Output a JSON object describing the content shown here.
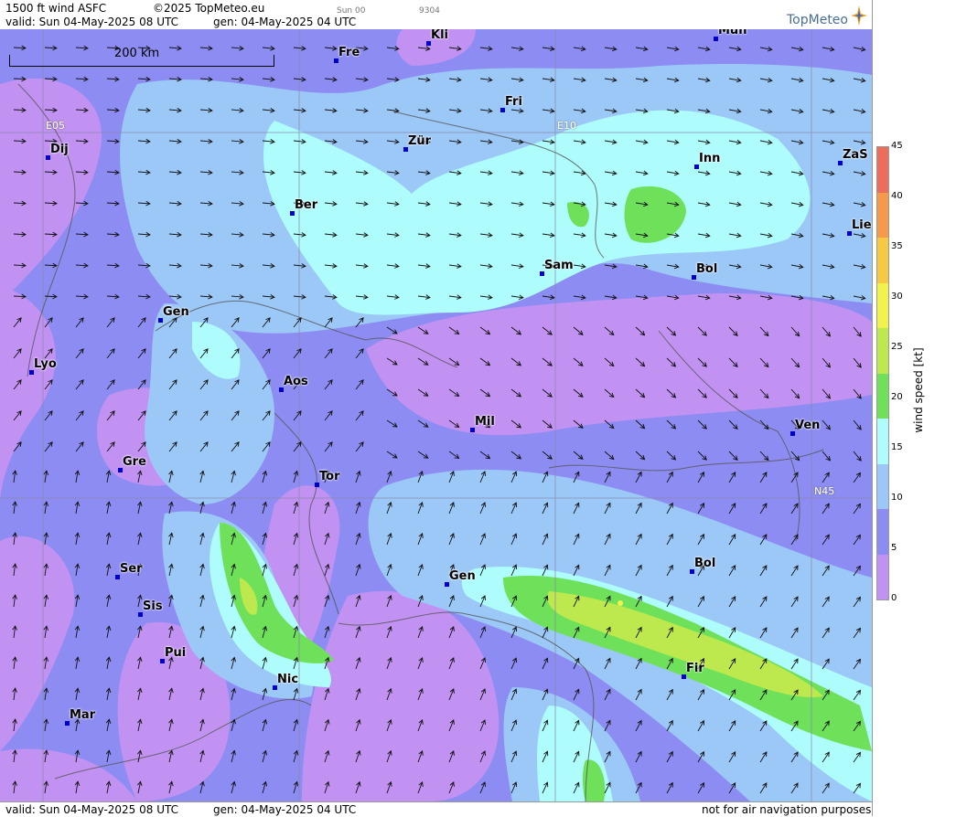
{
  "header": {
    "title": "1500 ft wind ASFC",
    "copyright": "©2025 TopMeteo.eu",
    "run_label": "Sun 00",
    "code": "9304",
    "valid": "valid:  Sun  04-May-2025  08 UTC",
    "gen": "gen: 04-May-2025 04 UTC",
    "logo": "TopMeteo"
  },
  "map": {
    "scale_label": "200 km",
    "grid_labels": [
      "E05",
      "E10",
      "N45"
    ],
    "cities": [
      "Kli",
      "Mün",
      "Fre",
      "Fri",
      "Dij",
      "Zür",
      "Inn",
      "ZaS",
      "Ber",
      "Lie",
      "Sam",
      "Bol",
      "Gen",
      "Lyo",
      "Aos",
      "Mil",
      "Ven",
      "Gre",
      "Tor",
      "Ser",
      "Gen",
      "Bol",
      "Sis",
      "Pui",
      "Nic",
      "Fir",
      "Mar"
    ]
  },
  "legend": {
    "unit": "wind speed [kt]",
    "ticks": [
      "45",
      "40",
      "35",
      "30",
      "25",
      "20",
      "15",
      "10",
      "5",
      "0"
    ],
    "colors": [
      "#ec6e5a",
      "#f49a4a",
      "#f6c843",
      "#f2f24c",
      "#bde94e",
      "#6ee05a",
      "#aefcfc",
      "#9cc8f8",
      "#8c8cf2",
      "#c292f2"
    ]
  },
  "footer": {
    "valid": "valid:  Sun  04-May-2025  08 UTC",
    "gen": "gen: 04-May-2025 04 UTC",
    "note": "not for air navigation purposes"
  }
}
